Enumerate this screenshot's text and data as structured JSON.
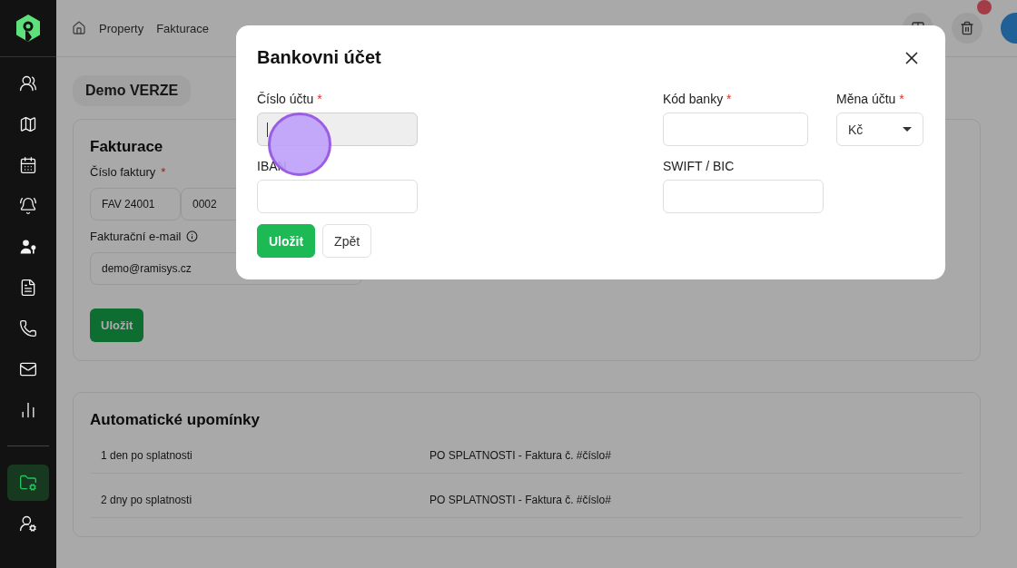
{
  "sidebar": {
    "items": [
      {
        "selected": false
      },
      {
        "selected": false
      },
      {
        "selected": false
      },
      {
        "selected": false
      },
      {
        "selected": false
      },
      {
        "selected": false
      },
      {
        "selected": false
      },
      {
        "selected": false
      },
      {
        "selected": false
      },
      {
        "selected": true
      },
      {
        "selected": false
      }
    ]
  },
  "breadcrumb": [
    "Property",
    "Fakturace"
  ],
  "page": {
    "badge": "Demo VERZE",
    "invoice_card": {
      "title": "Fakturace",
      "number_label": "Číslo faktury",
      "required_mark": "*",
      "number_parts": [
        "FAV 24001",
        "0002"
      ],
      "email_label": "Fakturační e-mail",
      "email_value": "demo@ramisys.cz",
      "save": "Uložit"
    },
    "reminders_card": {
      "title": "Automatické upomínky",
      "rows": [
        {
          "when": "1 den po splatnosti",
          "subject": "PO SPLATNOSTI - Faktura č. #číslo#"
        },
        {
          "when": "2 dny po splatnosti",
          "subject": "PO SPLATNOSTI - Faktura č. #číslo#"
        }
      ]
    }
  },
  "dialog": {
    "title": "Bankovni účet",
    "fields": [
      {
        "label": "Číslo účtu",
        "required_mark": "*",
        "kind": "text",
        "focused": true
      },
      {
        "label": "Kód banky",
        "required_mark": "*",
        "kind": "text",
        "focused": false
      },
      {
        "label": "Měna účtu",
        "required_mark": "*",
        "kind": "select",
        "value": "Kč"
      },
      {
        "label": "IBAN",
        "kind": "text",
        "focused": false
      },
      {
        "label": "SWIFT / BIC",
        "kind": "text",
        "focused": false
      }
    ],
    "buttons": [
      {
        "label": "Uložit",
        "kind": "primary"
      },
      {
        "label": "Zpět",
        "kind": "secondary"
      }
    ]
  }
}
